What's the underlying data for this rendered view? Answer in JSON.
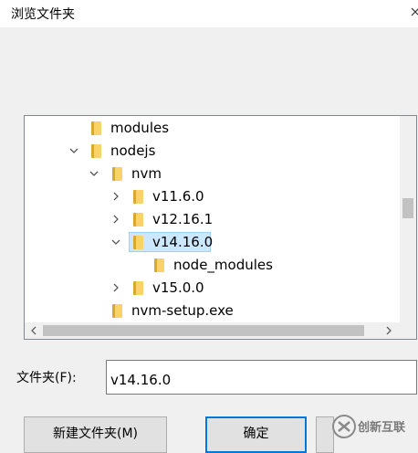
{
  "dialog": {
    "title": "浏览文件夹"
  },
  "tree": {
    "items": [
      {
        "label": "modules",
        "expander": "",
        "selected": false
      },
      {
        "label": "nodejs",
        "expander": "expanded",
        "selected": false
      },
      {
        "label": "nvm",
        "expander": "expanded",
        "selected": false
      },
      {
        "label": "v11.6.0",
        "expander": "collapsed",
        "selected": false
      },
      {
        "label": "v12.16.1",
        "expander": "collapsed",
        "selected": false
      },
      {
        "label": "v14.16.0",
        "expander": "expanded",
        "selected": true
      },
      {
        "label": "node_modules",
        "expander": "",
        "selected": false
      },
      {
        "label": "v15.0.0",
        "expander": "collapsed",
        "selected": false
      },
      {
        "label": "nvm-setup.exe",
        "expander": "",
        "selected": false
      }
    ]
  },
  "folder_field": {
    "label": "文件夹(F):",
    "value": "v14.16.0"
  },
  "buttons": {
    "new_folder": "新建文件夹(M)",
    "ok": "确定"
  },
  "watermark": {
    "text": "创新互联"
  },
  "colors": {
    "selection": "#cce8ff",
    "accent": "#0078d7",
    "folder": "#f7d36a"
  }
}
